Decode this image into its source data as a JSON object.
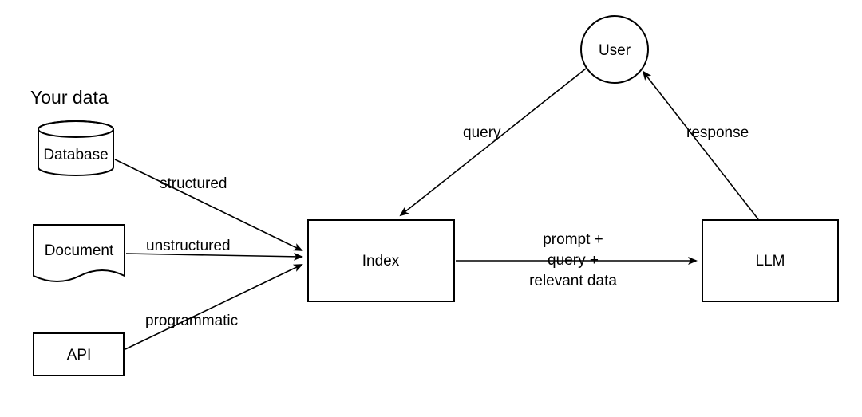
{
  "section_title": "Your data",
  "nodes": {
    "database": "Database",
    "document": "Document",
    "api": "API",
    "index": "Index",
    "user": "User",
    "llm": "LLM"
  },
  "edges": {
    "structured": "structured",
    "unstructured": "unstructured",
    "programmatic": "programmatic",
    "query": "query",
    "response": "response",
    "prompt_line1": "prompt +",
    "prompt_line2": "query +",
    "prompt_line3": "relevant data"
  }
}
